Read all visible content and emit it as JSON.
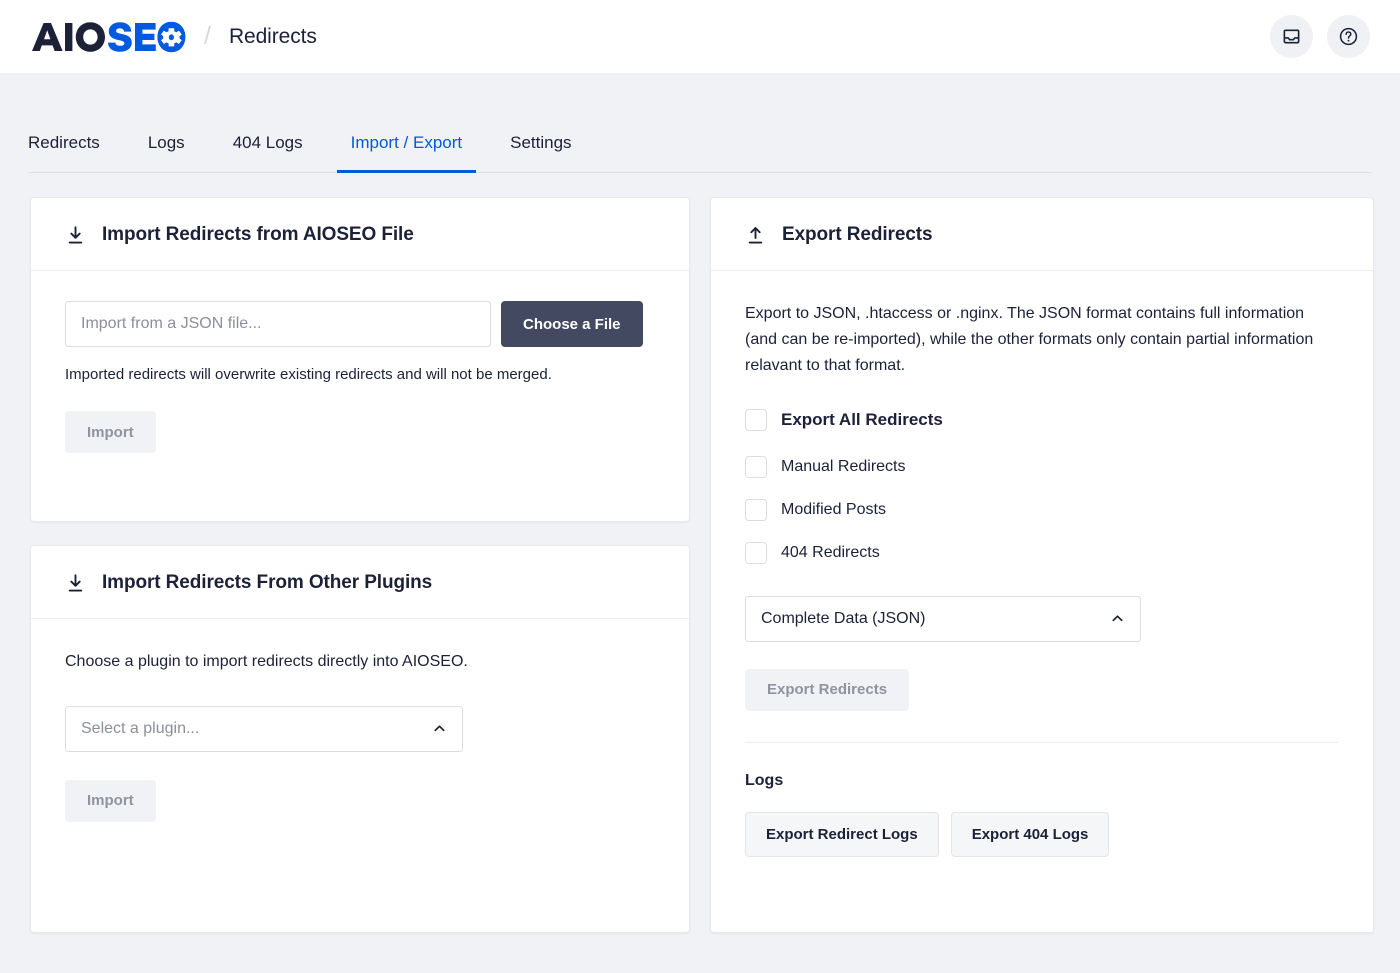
{
  "header": {
    "logo_alt": "AIOSEO",
    "logo_text_dark": "AIO",
    "logo_text_blue": "SE",
    "separator": "/",
    "breadcrumb": "Redirects",
    "actions": [
      {
        "name": "notifications-inbox-button",
        "icon": "inbox-icon"
      },
      {
        "name": "help-button",
        "icon": "question-circle-icon"
      }
    ]
  },
  "tabs": [
    {
      "label": "Redirects",
      "active": false
    },
    {
      "label": "Logs",
      "active": false
    },
    {
      "label": "404 Logs",
      "active": false
    },
    {
      "label": "Import / Export",
      "active": true
    },
    {
      "label": "Settings",
      "active": false
    }
  ],
  "import_file_card": {
    "title": "Import Redirects from AIOSEO File",
    "icon": "download-icon",
    "input_placeholder": "Import from a JSON file...",
    "input_value": "",
    "choose_file_label": "Choose a File",
    "hint": "Imported redirects will overwrite existing redirects and will not be merged.",
    "import_label": "Import",
    "import_disabled": true
  },
  "import_plugins_card": {
    "title": "Import Redirects From Other Plugins",
    "icon": "download-icon",
    "description": "Choose a plugin to import redirects directly into AIOSEO.",
    "select_value": "Select a plugin...",
    "select_is_placeholder": true,
    "select_chevron": "chevron-up-icon",
    "import_label": "Import",
    "import_disabled": true
  },
  "export_card": {
    "title": "Export Redirects",
    "icon": "upload-icon",
    "description": "Export to JSON, .htaccess or .nginx. The JSON format contains full information (and can be re-imported), while the other formats only contain partial information relavant to that format.",
    "checkbox_all": {
      "label": "Export All Redirects",
      "checked": false
    },
    "checkboxes": [
      {
        "label": "Manual Redirects",
        "checked": false
      },
      {
        "label": "Modified Posts",
        "checked": false
      },
      {
        "label": "404 Redirects",
        "checked": false
      }
    ],
    "format_value": "Complete Data (JSON)",
    "format_chevron": "chevron-up-icon",
    "export_label": "Export Redirects",
    "export_disabled": true,
    "logs_heading": "Logs",
    "export_redirect_logs_label": "Export Redirect Logs",
    "export_404_logs_label": "Export 404 Logs"
  },
  "colors": {
    "accent": "#005ae0",
    "dark": "#1c2138",
    "page_bg": "#f1f2f5",
    "button_dark": "#434960"
  }
}
